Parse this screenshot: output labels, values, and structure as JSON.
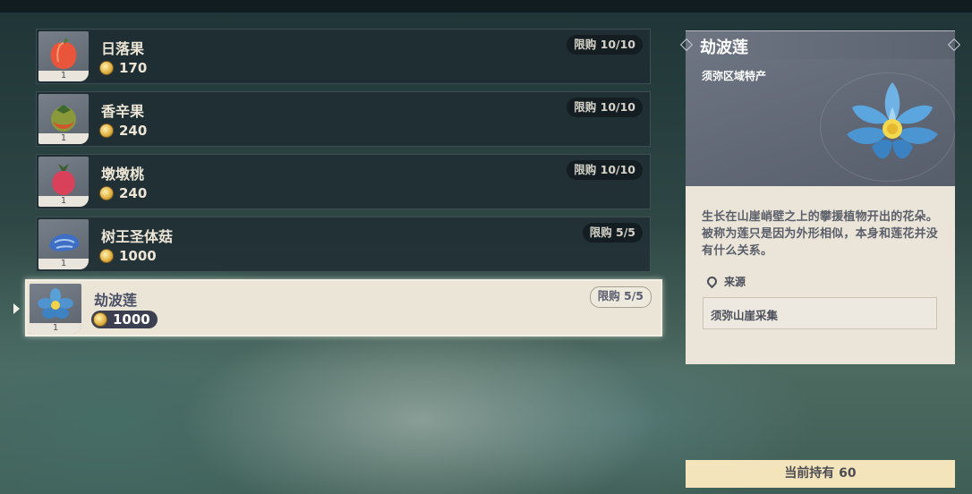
{
  "shop": {
    "items": [
      {
        "name": "日落果",
        "qty": "1",
        "price": "170",
        "limit": "限购 10/10"
      },
      {
        "name": "香辛果",
        "qty": "1",
        "price": "240",
        "limit": "限购 10/10"
      },
      {
        "name": "墩墩桃",
        "qty": "1",
        "price": "240",
        "limit": "限购 10/10"
      },
      {
        "name": "树王圣体菇",
        "qty": "1",
        "price": "1000",
        "limit": "限购 5/5"
      },
      {
        "name": "劫波莲",
        "qty": "1",
        "price": "1000",
        "limit": "限购 5/5",
        "selected": true
      }
    ]
  },
  "detail": {
    "title": "劫波莲",
    "subtitle": "须弥区域特产",
    "description": "生长在山崖峭壁之上的攀援植物开出的花朵。被称为莲只是因为外形相似，本身和莲花并没有什么关系。",
    "source_label": "来源",
    "source_value": "须弥山崖采集"
  },
  "footer": {
    "holding": "当前持有 60"
  },
  "icons": {
    "currency": "mora-coin-icon",
    "location": "location-pin-icon"
  },
  "colors": {
    "selected_row": "#ebe5d7",
    "holding_bar": "#f3e4bb"
  }
}
